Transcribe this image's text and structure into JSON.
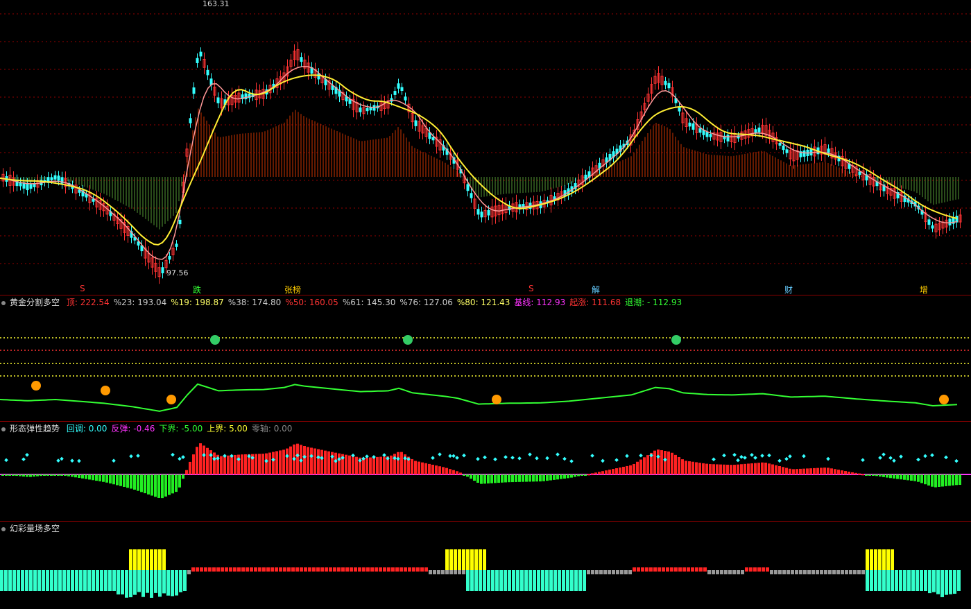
{
  "main": {
    "high_label": "163.31",
    "low_label": "97.56",
    "event_tags": [
      {
        "text": "S",
        "color": "#ff3333"
      },
      {
        "text": "跌",
        "color": "#33ff33"
      },
      {
        "text": "张榜",
        "color": "#ffcc00"
      },
      {
        "text": "S",
        "color": "#ff3333"
      },
      {
        "text": "解",
        "color": "#66ccff"
      },
      {
        "text": "财",
        "color": "#66ccff"
      },
      {
        "text": "增",
        "color": "#ffcc00"
      }
    ]
  },
  "pane1": {
    "title": "黄金分割多空",
    "items": [
      {
        "label": "顶:",
        "value": "222.54",
        "color": "#ff3333"
      },
      {
        "label": "%23:",
        "value": "193.04",
        "color": "#cccccc"
      },
      {
        "label": "%19:",
        "value": "198.87",
        "color": "#ffff66"
      },
      {
        "label": "%38:",
        "value": "174.80",
        "color": "#cccccc"
      },
      {
        "label": "%50:",
        "value": "160.05",
        "color": "#ff3333"
      },
      {
        "label": "%61:",
        "value": "145.30",
        "color": "#cccccc"
      },
      {
        "label": "%76:",
        "value": "127.06",
        "color": "#cccccc"
      },
      {
        "label": "%80:",
        "value": "121.43",
        "color": "#ffff66"
      },
      {
        "label": "基线:",
        "value": "112.93",
        "color": "#ff33ff"
      },
      {
        "label": "起涨:",
        "value": "111.68",
        "color": "#ff3333"
      },
      {
        "label": "退潮:",
        "value": "- 112.93",
        "color": "#33ff33"
      }
    ]
  },
  "pane2": {
    "title": "形态弹性趋势",
    "items": [
      {
        "label": "回调:",
        "value": "0.00",
        "color": "#33ffff"
      },
      {
        "label": "反弹:",
        "value": "-0.46",
        "color": "#ff33ff"
      },
      {
        "label": "下界:",
        "value": "-5.00",
        "color": "#33ff33"
      },
      {
        "label": "上界:",
        "value": "5.00",
        "color": "#ffff33"
      },
      {
        "label": "零轴:",
        "value": "0.00",
        "color": "#888888"
      }
    ]
  },
  "pane3": {
    "title": "幻彩量场多空"
  },
  "colors": {
    "up": "#ff3333",
    "down": "#33ffff",
    "ma_fast": "#ff9999",
    "ma_slow": "#ffee33",
    "grid": "#aa0000",
    "separator": "#8b0000"
  }
}
